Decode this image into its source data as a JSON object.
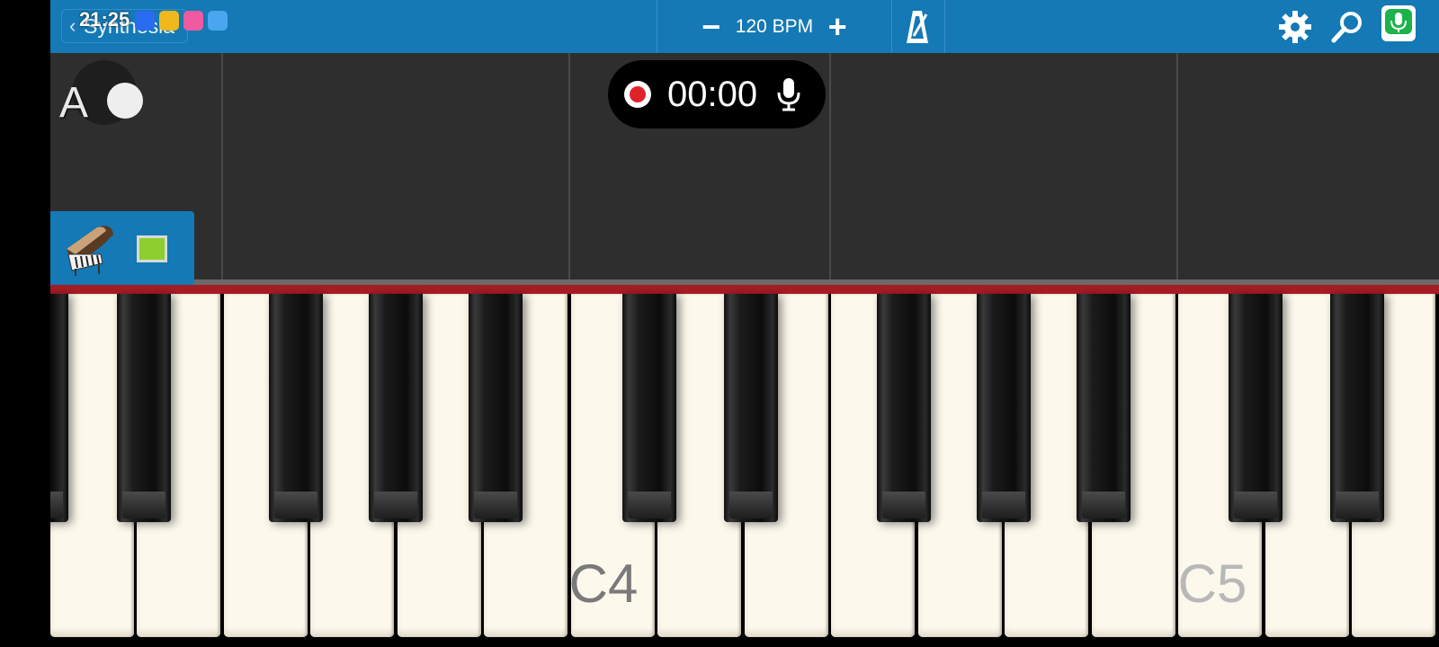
{
  "status_bar": {
    "time": "21:25"
  },
  "top_bar": {
    "back_label": "Synthesia",
    "tempo": {
      "minus_label": "−",
      "plus_label": "+",
      "value_label": "120 BPM"
    }
  },
  "toolbar_icons": [
    "metronome-icon",
    "gear-icon",
    "search-icon",
    "microphone-icon"
  ],
  "overlay": {
    "key_letter": "A"
  },
  "recorder": {
    "time": "00:00"
  },
  "keyboard": {
    "label_c4": "C4",
    "label_c5": "C5"
  },
  "colors": {
    "accent": "#1479b5",
    "record": "#e0232a",
    "strip": "#a61c24",
    "white_key": "#fcf8ec"
  }
}
